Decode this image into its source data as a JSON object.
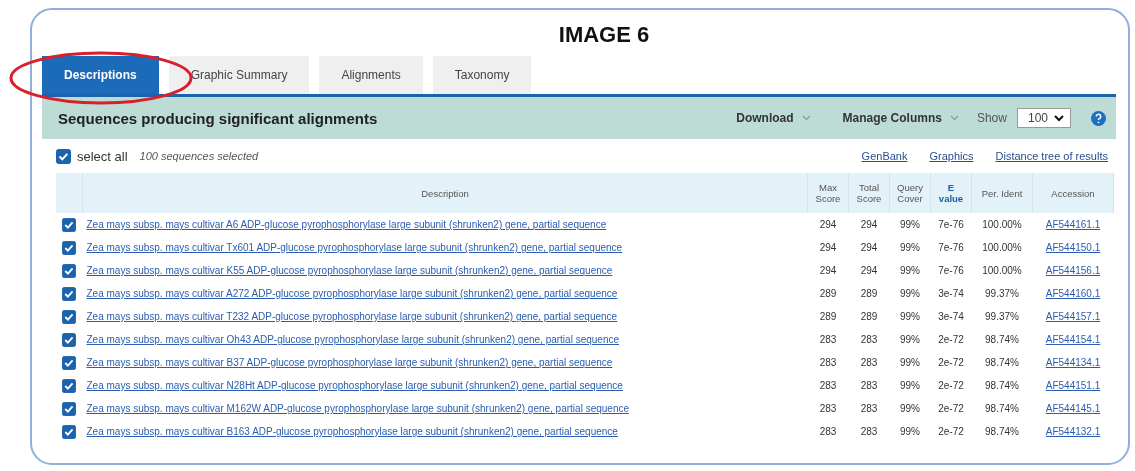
{
  "title": "IMAGE 6",
  "tabs": [
    {
      "label": "Descriptions",
      "selected": true
    },
    {
      "label": "Graphic Summary",
      "selected": false
    },
    {
      "label": "Alignments",
      "selected": false
    },
    {
      "label": "Taxonomy",
      "selected": false
    }
  ],
  "toolbar": {
    "heading": "Sequences producing significant alignments",
    "download": "Download",
    "manage_columns": "Manage Columns",
    "show_label": "Show",
    "show_value": "100"
  },
  "select_all": {
    "label": "select all",
    "checked": true,
    "count_text": "100 sequences selected"
  },
  "links": [
    "GenBank",
    "Graphics",
    "Distance tree of results"
  ],
  "table": {
    "columns": [
      "Description",
      "Max Score",
      "Total Score",
      "Query Cover",
      "E value",
      "Per. Ident",
      "Accession"
    ],
    "rows": [
      {
        "checked": true,
        "description": "Zea mays subsp. mays cultivar A6 ADP-glucose pyrophosphorylase large subunit (shrunken2) gene, partial sequence",
        "max_score": "294",
        "total_score": "294",
        "query_cover": "99%",
        "e_value": "7e-76",
        "per_ident": "100.00%",
        "accession": "AF544161.1"
      },
      {
        "checked": true,
        "description": "Zea mays subsp. mays cultivar Tx601 ADP-glucose pyrophosphorylase large subunit (shrunken2) gene, partial sequence",
        "max_score": "294",
        "total_score": "294",
        "query_cover": "99%",
        "e_value": "7e-76",
        "per_ident": "100.00%",
        "accession": "AF544150.1"
      },
      {
        "checked": true,
        "description": "Zea mays subsp. mays cultivar K55 ADP-glucose pyrophosphorylase large subunit (shrunken2) gene, partial sequence",
        "max_score": "294",
        "total_score": "294",
        "query_cover": "99%",
        "e_value": "7e-76",
        "per_ident": "100.00%",
        "accession": "AF544156.1"
      },
      {
        "checked": true,
        "description": "Zea mays subsp. mays cultivar A272 ADP-glucose pyrophosphorylase large subunit (shrunken2) gene, partial sequence",
        "max_score": "289",
        "total_score": "289",
        "query_cover": "99%",
        "e_value": "3e-74",
        "per_ident": "99.37%",
        "accession": "AF544160.1"
      },
      {
        "checked": true,
        "description": "Zea mays subsp. mays cultivar T232 ADP-glucose pyrophosphorylase large subunit (shrunken2) gene, partial sequence",
        "max_score": "289",
        "total_score": "289",
        "query_cover": "99%",
        "e_value": "3e-74",
        "per_ident": "99.37%",
        "accession": "AF544157.1"
      },
      {
        "checked": true,
        "description": "Zea mays subsp. mays cultivar Oh43 ADP-glucose pyrophosphorylase large subunit (shrunken2) gene, partial sequence",
        "max_score": "283",
        "total_score": "283",
        "query_cover": "99%",
        "e_value": "2e-72",
        "per_ident": "98.74%",
        "accession": "AF544154.1"
      },
      {
        "checked": true,
        "description": "Zea mays subsp. mays cultivar B37 ADP-glucose pyrophosphorylase large subunit (shrunken2) gene, partial sequence",
        "max_score": "283",
        "total_score": "283",
        "query_cover": "99%",
        "e_value": "2e-72",
        "per_ident": "98.74%",
        "accession": "AF544134.1"
      },
      {
        "checked": true,
        "description": "Zea mays subsp. mays cultivar N28Ht ADP-glucose pyrophosphorylase large subunit (shrunken2) gene, partial sequence",
        "max_score": "283",
        "total_score": "283",
        "query_cover": "99%",
        "e_value": "2e-72",
        "per_ident": "98.74%",
        "accession": "AF544151.1"
      },
      {
        "checked": true,
        "description": "Zea mays subsp. mays cultivar M162W ADP-glucose pyrophosphorylase large subunit (shrunken2) gene, partial sequence",
        "max_score": "283",
        "total_score": "283",
        "query_cover": "99%",
        "e_value": "2e-72",
        "per_ident": "98.74%",
        "accession": "AF544145.1"
      },
      {
        "checked": true,
        "description": "Zea mays subsp. mays cultivar B163 ADP-glucose pyrophosphorylase large subunit (shrunken2) gene, partial sequence",
        "max_score": "283",
        "total_score": "283",
        "query_cover": "99%",
        "e_value": "2e-72",
        "per_ident": "98.74%",
        "accession": "AF544132.1"
      }
    ]
  }
}
